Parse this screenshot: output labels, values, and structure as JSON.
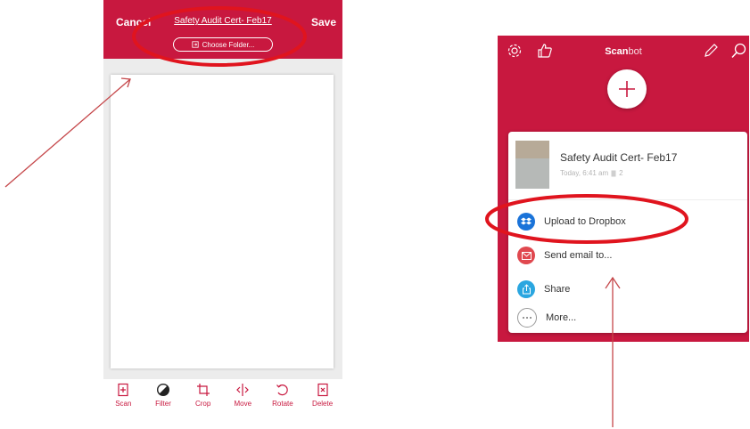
{
  "left_screen": {
    "header": {
      "cancel_label": "Cancel",
      "save_label": "Save",
      "title": "Safety Audit Cert- Feb17",
      "choose_folder_label": "Choose Folder..."
    },
    "toolbar": [
      {
        "label": "Scan",
        "icon": "scan-plus-icon"
      },
      {
        "label": "Filter",
        "icon": "filter-icon"
      },
      {
        "label": "Crop",
        "icon": "crop-icon"
      },
      {
        "label": "Move",
        "icon": "move-icon"
      },
      {
        "label": "Rotate",
        "icon": "rotate-icon"
      },
      {
        "label": "Delete",
        "icon": "delete-icon"
      }
    ]
  },
  "right_screen": {
    "app_title_bold": "Scan",
    "app_title_light": "bot",
    "document": {
      "name": "Safety Audit Cert- Feb17",
      "meta": "Today, 6:41 am",
      "page_count": "2"
    },
    "actions": [
      {
        "label": "Upload to Dropbox",
        "icon": "dropbox-icon",
        "color": "#1a73d9"
      },
      {
        "label": "Send email to...",
        "icon": "email-icon",
        "color": "#e0484f"
      },
      {
        "label": "Share",
        "icon": "share-icon",
        "color": "#2aa6e0"
      },
      {
        "label": "More...",
        "icon": "more-icon",
        "color": "#ffffff"
      }
    ]
  },
  "colors": {
    "brand": "#c8183f",
    "annotation": "#e0141e",
    "arrow": "#c5474a"
  }
}
